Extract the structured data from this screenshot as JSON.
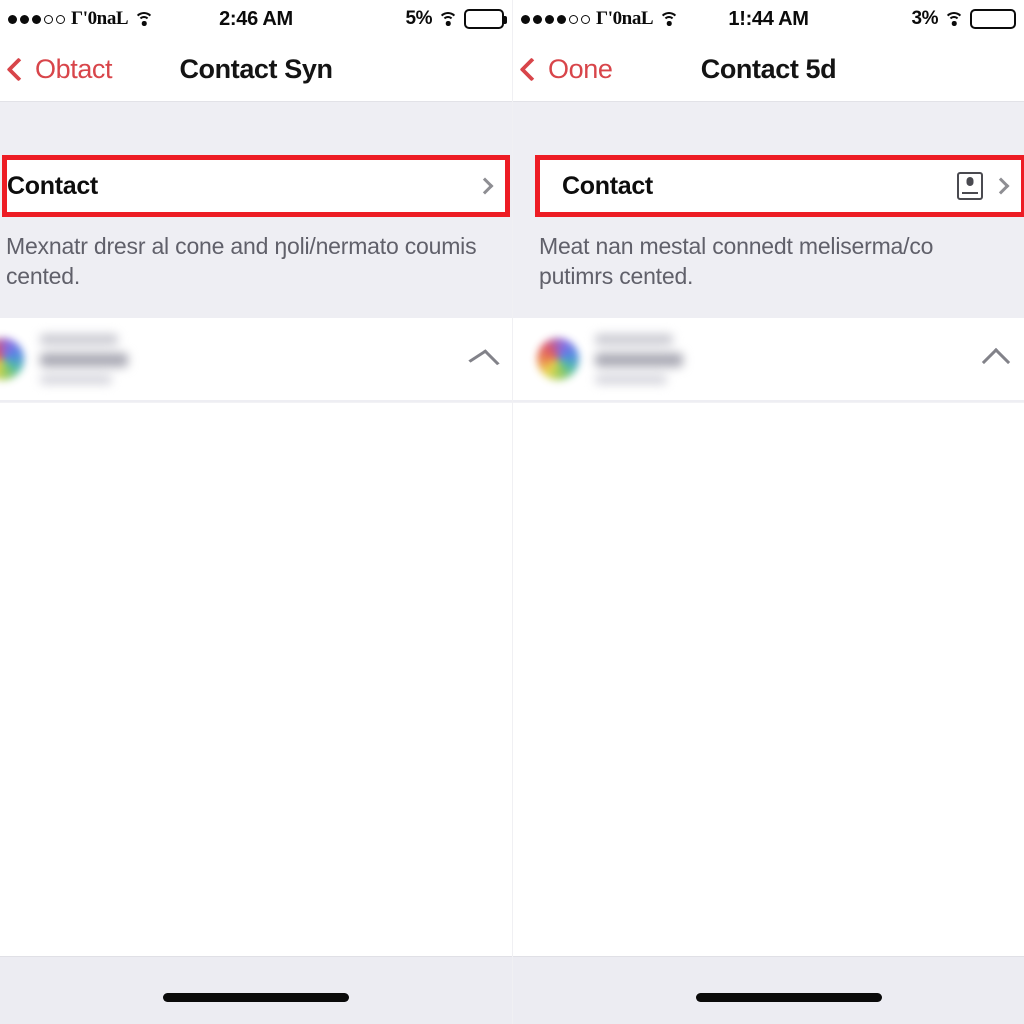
{
  "panels": [
    {
      "id": "left",
      "status_bar": {
        "signal_filled": 3,
        "signal_empty": 2,
        "carrier": "Γ'0naL",
        "wifi_icon": "wifi-icon",
        "time": "2:46 AM",
        "battery_percent": "5%",
        "battery_wifi_icon": "wifi-icon",
        "battery_icon": "battery-icon",
        "battery_fill_pct": 72
      },
      "nav": {
        "back_icon": "chevron-left-icon",
        "back_label": "Obtact",
        "title": "Contact Syn"
      },
      "row": {
        "title": "Contact",
        "has_card_icon": false,
        "card_icon": "contact-card-icon",
        "chevron_icon": "chevron-right-icon",
        "highlight_color": "#ed1c24"
      },
      "description": "Mexnatr dresr al cone and ŋoli/nermato coumis cented.",
      "blurred_item": {
        "avatar_icon": "avatar",
        "line1": "",
        "line2": "",
        "line3": "",
        "collapse_icon": "chevron-up-icon"
      },
      "home_indicator": "home-indicator"
    },
    {
      "id": "right",
      "status_bar": {
        "signal_filled": 4,
        "signal_empty": 2,
        "carrier": "Γ'0naL",
        "wifi_icon": "wifi-icon",
        "time": "1!:44 AM",
        "battery_percent": "3%",
        "battery_wifi_icon": "wifi-icon",
        "battery_icon": "battery-icon",
        "battery_fill_pct": 100
      },
      "nav": {
        "back_icon": "chevron-left-icon",
        "back_label": "Oone",
        "title": "Contact 5d"
      },
      "row": {
        "title": "Contact",
        "has_card_icon": true,
        "card_icon": "contact-card-icon",
        "chevron_icon": "chevron-right-icon",
        "highlight_color": "#ed1c24"
      },
      "description": "Meat nan mestal connedt meliserma/co putimrs cented.",
      "blurred_item": {
        "avatar_icon": "avatar",
        "line1": "",
        "line2": "",
        "line3": "",
        "collapse_icon": "chevron-up-icon"
      },
      "home_indicator": "home-indicator"
    }
  ],
  "colors": {
    "accent_red": "#d8454a",
    "highlight_red": "#ed1c24",
    "background": "#eeeef3",
    "card": "#ffffff",
    "text_primary": "#0d0d0d",
    "text_secondary": "#60606a"
  }
}
